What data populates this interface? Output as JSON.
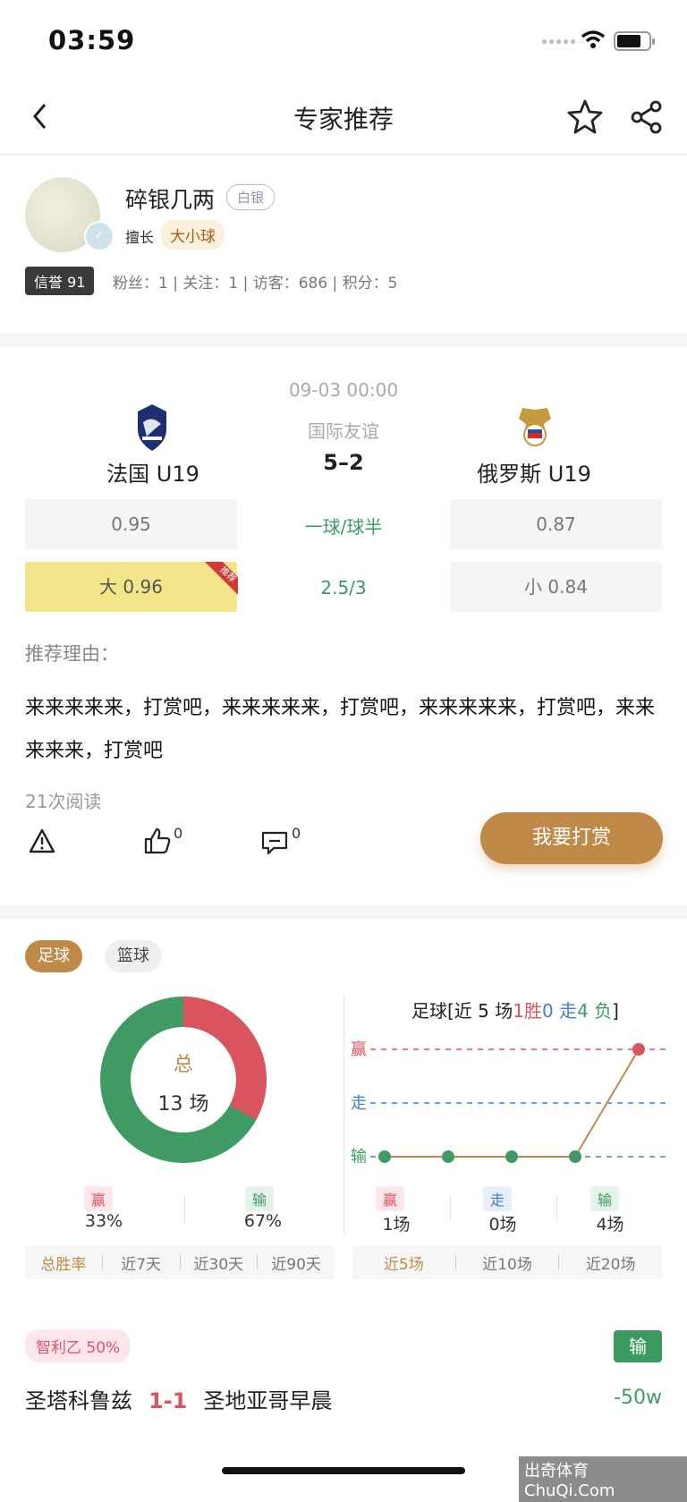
{
  "status_bar": {
    "time": "03:59"
  },
  "header": {
    "title": "专家推荐"
  },
  "profile": {
    "name": "碎银几两",
    "level": "白银",
    "good_at_label": "擅长",
    "good_at": "大小球",
    "credit": "信誉 91",
    "stats": "粉丝：1 | 关注：1 | 访客：686 | 积分：5"
  },
  "match": {
    "datetime": "09-03 00:00",
    "league": "国际友谊",
    "score": "5–2",
    "home": "法国 U19",
    "away": "俄罗斯 U19",
    "handicap": {
      "home_odds": "0.95",
      "line": "一球/球半",
      "away_odds": "0.87"
    },
    "total": {
      "over": "大 0.96",
      "line": "2.5/3",
      "under": "小 0.84",
      "recommend_flag": "推荐"
    }
  },
  "reason": {
    "label": "推荐理由：",
    "text": "来来来来来，打赏吧，来来来来来，打赏吧，来来来来来，打赏吧，来来来来来，打赏吧"
  },
  "reads": "21次阅读",
  "actions": {
    "likes": "0",
    "comments": "0",
    "tip_label": "我要打赏"
  },
  "sports_tabs": [
    {
      "label": "足球"
    },
    {
      "label": "篮球"
    }
  ],
  "summary": {
    "total_label": "总",
    "count": "13 场",
    "win_label": "赢",
    "win_pct": "33%",
    "lose_label": "输",
    "lose_pct": "67%",
    "win_fraction": 0.33,
    "periods": [
      "总胜率",
      "近7天",
      "近30天",
      "近90天"
    ]
  },
  "trend": {
    "title_prefix": "足球[近 5 场",
    "win": "1胜",
    "draw": "0 走",
    "lose": "4 负",
    "title_suffix": "]",
    "axis": [
      "赢",
      "走",
      "输"
    ],
    "results": [
      "输",
      "输",
      "输",
      "输",
      "赢"
    ],
    "win_label": "赢",
    "win_count": "1场",
    "draw_label": "走",
    "draw_count": "0场",
    "lose_label": "输",
    "lose_count": "4场",
    "periods": [
      "近5场",
      "近10场",
      "近20场"
    ]
  },
  "recent": {
    "league": "智利乙 50%",
    "result": "输",
    "home": "圣塔科鲁兹",
    "score": "1-1",
    "away": "圣地亚哥早晨",
    "amount": "-50w"
  },
  "watermark": "出奇体育 ChuQi.Com",
  "colors": {
    "accent": "#bf8a48",
    "win": "#d9545e",
    "lose": "#3f9a64",
    "draw": "#3f7fd0"
  }
}
